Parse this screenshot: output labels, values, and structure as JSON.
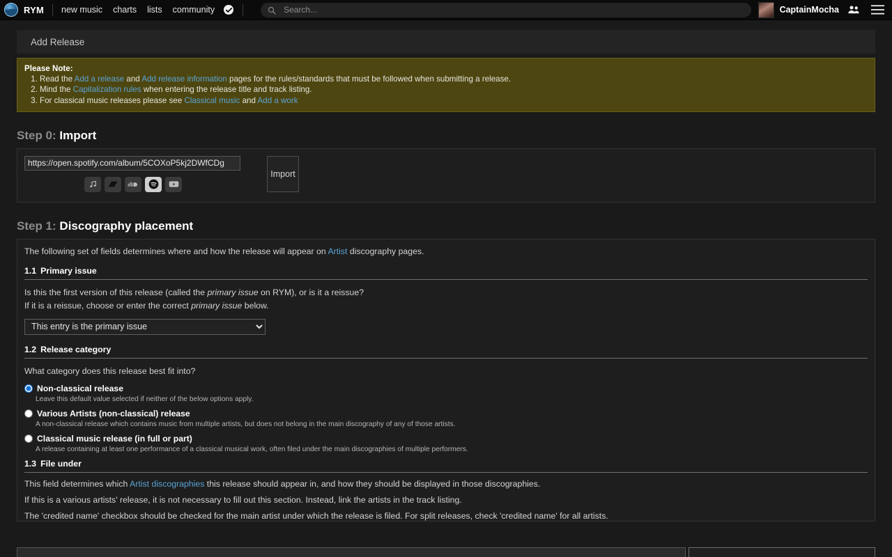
{
  "topnav": {
    "brand": "RYM",
    "links": [
      {
        "label": "new music"
      },
      {
        "label": "charts"
      },
      {
        "label": "lists"
      },
      {
        "label": "community"
      }
    ],
    "verified_icon": "check-circle-icon",
    "search": {
      "placeholder": "Search...",
      "value": "",
      "icon": "search-icon"
    },
    "user": {
      "name": "CaptainMocha",
      "avatar_icon": "avatar",
      "friends_icon": "people-icon",
      "menu_icon": "hamburger-menu-icon"
    }
  },
  "page": {
    "header_title": "Add Release"
  },
  "note": {
    "title": "Please Note:",
    "items": [
      {
        "parts": [
          {
            "t": "Read the ",
            "link": false
          },
          {
            "t": "Add a release",
            "link": true
          },
          {
            "t": " and ",
            "link": false
          },
          {
            "t": "Add release information",
            "link": true
          },
          {
            "t": " pages for the rules/standards that must be followed when submitting a release.",
            "link": false
          }
        ]
      },
      {
        "parts": [
          {
            "t": "Mind the ",
            "link": false
          },
          {
            "t": "Capitalization rules",
            "link": true
          },
          {
            "t": " when entering the release title and track listing.",
            "link": false
          }
        ]
      },
      {
        "parts": [
          {
            "t": "For classical music releases please see ",
            "link": false
          },
          {
            "t": "Classical music",
            "link": true
          },
          {
            "t": " and ",
            "link": false
          },
          {
            "t": "Add a work",
            "link": true
          }
        ]
      }
    ]
  },
  "step0": {
    "step_label": "Step 0:",
    "title": "Import",
    "url_value": "https://open.spotify.com/album/5COXoP5kj2DWfCDg",
    "url_placeholder": "",
    "import_button": "Import",
    "services": [
      {
        "name": "apple-music-icon",
        "selected": false
      },
      {
        "name": "bandcamp-icon",
        "selected": false
      },
      {
        "name": "soundcloud-icon",
        "selected": false
      },
      {
        "name": "spotify-icon",
        "selected": true
      },
      {
        "name": "youtube-icon",
        "selected": false
      }
    ]
  },
  "step1": {
    "step_label": "Step 1:",
    "title": "Discography placement",
    "lead_before": "The following set of fields determines where and how the release will appear on ",
    "lead_link": "Artist",
    "lead_after": " discography pages.",
    "s11": {
      "num": "1.1",
      "title": "Primary issue",
      "q_line1_a": "Is this the first version of this release (called the ",
      "q_line1_em": "primary issue",
      "q_line1_b": " on RYM), or is it a reissue?",
      "q_line2_a": "If it is a reissue, choose or enter the correct ",
      "q_line2_em": "primary issue",
      "q_line2_b": " below.",
      "select_value": "This entry is the primary issue",
      "select_options": [
        "This entry is the primary issue"
      ]
    },
    "s12": {
      "num": "1.2",
      "title": "Release category",
      "question": "What category does this release best fit into?",
      "options": [
        {
          "label": "Non-classical release",
          "desc": "Leave this default value selected if neither of the below options apply.",
          "selected": true
        },
        {
          "label": "Various Artists (non-classical) release",
          "desc": "A non-classical release which contains music from multiple artists, but does not belong in the main discography of any of those artists.",
          "selected": false
        },
        {
          "label": "Classical music release (in full or part)",
          "desc": "A release containing at least one performance of a classical musical work, often filed under the main discographies of multiple performers.",
          "selected": false
        }
      ]
    },
    "s13": {
      "num": "1.3",
      "title": "File under",
      "line1_a": "This field determines which ",
      "line1_link": "Artist discographies",
      "line1_b": " this release should appear in, and how they should be displayed in those discographies.",
      "line2": "If this is a various artists' release, it is not necessary to fill out this section. Instead, link the artists in the track listing.",
      "line3": "The 'credited name' checkbox should be checked for the main artist under which the release is filed. For split releases, check 'credited name' for all artists."
    }
  },
  "colors": {
    "page_bg": "#1a1a1a",
    "nav_bg": "#0b0b0b",
    "note_bg": "#4e4610",
    "link": "#5aa3d6",
    "accent_radio": "#1573d8",
    "panel_bg": "#1e1e1e"
  }
}
